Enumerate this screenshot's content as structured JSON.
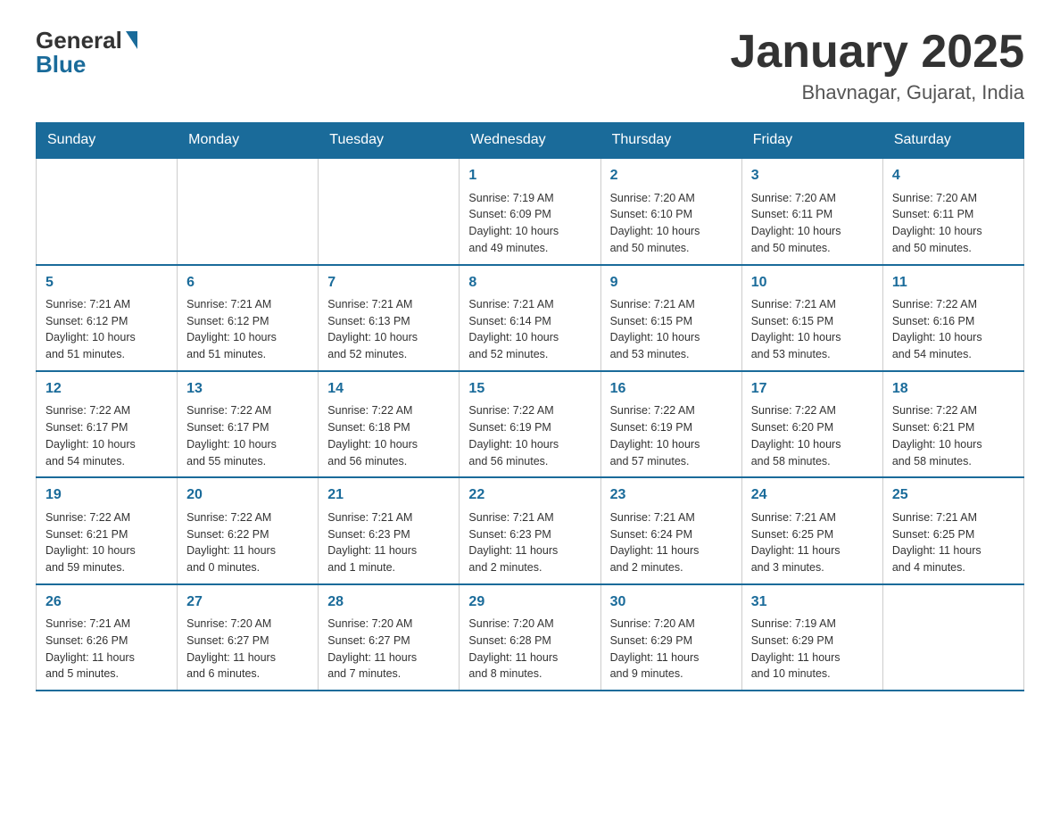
{
  "header": {
    "logo_general": "General",
    "logo_blue": "Blue",
    "month_title": "January 2025",
    "location": "Bhavnagar, Gujarat, India"
  },
  "calendar": {
    "headers": [
      "Sunday",
      "Monday",
      "Tuesday",
      "Wednesday",
      "Thursday",
      "Friday",
      "Saturday"
    ],
    "weeks": [
      [
        {
          "day": "",
          "info": ""
        },
        {
          "day": "",
          "info": ""
        },
        {
          "day": "",
          "info": ""
        },
        {
          "day": "1",
          "info": "Sunrise: 7:19 AM\nSunset: 6:09 PM\nDaylight: 10 hours\nand 49 minutes."
        },
        {
          "day": "2",
          "info": "Sunrise: 7:20 AM\nSunset: 6:10 PM\nDaylight: 10 hours\nand 50 minutes."
        },
        {
          "day": "3",
          "info": "Sunrise: 7:20 AM\nSunset: 6:11 PM\nDaylight: 10 hours\nand 50 minutes."
        },
        {
          "day": "4",
          "info": "Sunrise: 7:20 AM\nSunset: 6:11 PM\nDaylight: 10 hours\nand 50 minutes."
        }
      ],
      [
        {
          "day": "5",
          "info": "Sunrise: 7:21 AM\nSunset: 6:12 PM\nDaylight: 10 hours\nand 51 minutes."
        },
        {
          "day": "6",
          "info": "Sunrise: 7:21 AM\nSunset: 6:12 PM\nDaylight: 10 hours\nand 51 minutes."
        },
        {
          "day": "7",
          "info": "Sunrise: 7:21 AM\nSunset: 6:13 PM\nDaylight: 10 hours\nand 52 minutes."
        },
        {
          "day": "8",
          "info": "Sunrise: 7:21 AM\nSunset: 6:14 PM\nDaylight: 10 hours\nand 52 minutes."
        },
        {
          "day": "9",
          "info": "Sunrise: 7:21 AM\nSunset: 6:15 PM\nDaylight: 10 hours\nand 53 minutes."
        },
        {
          "day": "10",
          "info": "Sunrise: 7:21 AM\nSunset: 6:15 PM\nDaylight: 10 hours\nand 53 minutes."
        },
        {
          "day": "11",
          "info": "Sunrise: 7:22 AM\nSunset: 6:16 PM\nDaylight: 10 hours\nand 54 minutes."
        }
      ],
      [
        {
          "day": "12",
          "info": "Sunrise: 7:22 AM\nSunset: 6:17 PM\nDaylight: 10 hours\nand 54 minutes."
        },
        {
          "day": "13",
          "info": "Sunrise: 7:22 AM\nSunset: 6:17 PM\nDaylight: 10 hours\nand 55 minutes."
        },
        {
          "day": "14",
          "info": "Sunrise: 7:22 AM\nSunset: 6:18 PM\nDaylight: 10 hours\nand 56 minutes."
        },
        {
          "day": "15",
          "info": "Sunrise: 7:22 AM\nSunset: 6:19 PM\nDaylight: 10 hours\nand 56 minutes."
        },
        {
          "day": "16",
          "info": "Sunrise: 7:22 AM\nSunset: 6:19 PM\nDaylight: 10 hours\nand 57 minutes."
        },
        {
          "day": "17",
          "info": "Sunrise: 7:22 AM\nSunset: 6:20 PM\nDaylight: 10 hours\nand 58 minutes."
        },
        {
          "day": "18",
          "info": "Sunrise: 7:22 AM\nSunset: 6:21 PM\nDaylight: 10 hours\nand 58 minutes."
        }
      ],
      [
        {
          "day": "19",
          "info": "Sunrise: 7:22 AM\nSunset: 6:21 PM\nDaylight: 10 hours\nand 59 minutes."
        },
        {
          "day": "20",
          "info": "Sunrise: 7:22 AM\nSunset: 6:22 PM\nDaylight: 11 hours\nand 0 minutes."
        },
        {
          "day": "21",
          "info": "Sunrise: 7:21 AM\nSunset: 6:23 PM\nDaylight: 11 hours\nand 1 minute."
        },
        {
          "day": "22",
          "info": "Sunrise: 7:21 AM\nSunset: 6:23 PM\nDaylight: 11 hours\nand 2 minutes."
        },
        {
          "day": "23",
          "info": "Sunrise: 7:21 AM\nSunset: 6:24 PM\nDaylight: 11 hours\nand 2 minutes."
        },
        {
          "day": "24",
          "info": "Sunrise: 7:21 AM\nSunset: 6:25 PM\nDaylight: 11 hours\nand 3 minutes."
        },
        {
          "day": "25",
          "info": "Sunrise: 7:21 AM\nSunset: 6:25 PM\nDaylight: 11 hours\nand 4 minutes."
        }
      ],
      [
        {
          "day": "26",
          "info": "Sunrise: 7:21 AM\nSunset: 6:26 PM\nDaylight: 11 hours\nand 5 minutes."
        },
        {
          "day": "27",
          "info": "Sunrise: 7:20 AM\nSunset: 6:27 PM\nDaylight: 11 hours\nand 6 minutes."
        },
        {
          "day": "28",
          "info": "Sunrise: 7:20 AM\nSunset: 6:27 PM\nDaylight: 11 hours\nand 7 minutes."
        },
        {
          "day": "29",
          "info": "Sunrise: 7:20 AM\nSunset: 6:28 PM\nDaylight: 11 hours\nand 8 minutes."
        },
        {
          "day": "30",
          "info": "Sunrise: 7:20 AM\nSunset: 6:29 PM\nDaylight: 11 hours\nand 9 minutes."
        },
        {
          "day": "31",
          "info": "Sunrise: 7:19 AM\nSunset: 6:29 PM\nDaylight: 11 hours\nand 10 minutes."
        },
        {
          "day": "",
          "info": ""
        }
      ]
    ]
  }
}
